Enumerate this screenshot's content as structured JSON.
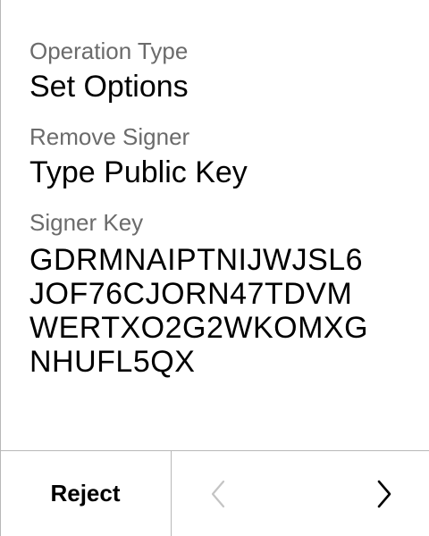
{
  "operation": {
    "label": "Operation Type",
    "value": "Set Options"
  },
  "signer_action": {
    "label": "Remove Signer",
    "value": "Type Public Key"
  },
  "signer_key": {
    "label": "Signer Key",
    "lines": [
      "GDRMNAIPTNIJWJSL6",
      "JOF76CJORN47TDVM",
      "WERTXO2G2WKOMXG",
      "NHUFL5QX"
    ]
  },
  "footer": {
    "reject_label": "Reject",
    "prev_icon": "chevron-left-icon",
    "next_icon": "chevron-right-icon"
  },
  "colors": {
    "label": "#6b6b6b",
    "value": "#000000",
    "border": "#b8b8b8",
    "disabled_icon": "#c4c4c4"
  }
}
